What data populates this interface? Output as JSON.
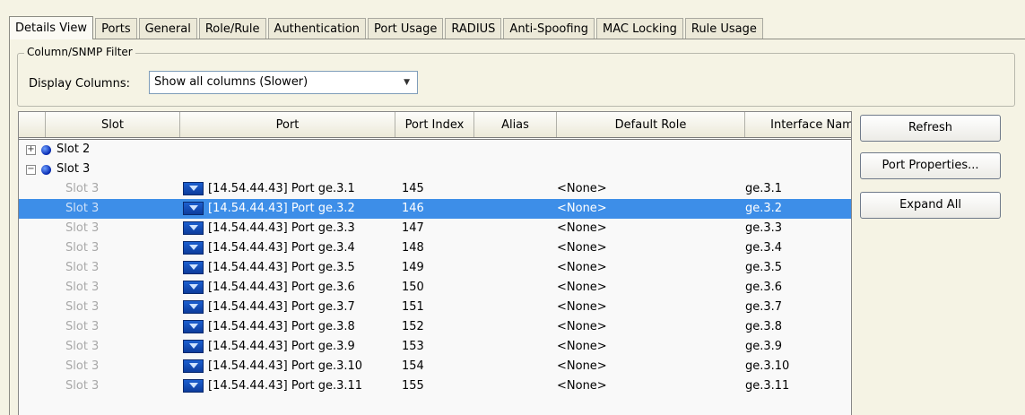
{
  "tabs": [
    "Details View",
    "Ports",
    "General",
    "Role/Rule",
    "Authentication",
    "Port Usage",
    "RADIUS",
    "Anti-Spoofing",
    "MAC Locking",
    "Rule Usage"
  ],
  "filter": {
    "group_title": "Column/SNMP Filter",
    "display_columns_label": "Display Columns:",
    "display_columns_value": "Show all columns (Slower)"
  },
  "table": {
    "columns": [
      "",
      "Slot",
      "Port",
      "Port Index",
      "Alias",
      "Default Role",
      "Interface Nam"
    ],
    "slots": [
      {
        "expander": "+",
        "label": "Slot 2"
      },
      {
        "expander": "−",
        "label": "Slot 3"
      }
    ],
    "rows": [
      {
        "slot": "Slot 3",
        "port": "[14.54.44.43] Port ge.3.1",
        "index": "145",
        "alias": "",
        "role": "<None>",
        "iface": "ge.3.1"
      },
      {
        "slot": "Slot 3",
        "port": "[14.54.44.43] Port ge.3.2",
        "index": "146",
        "alias": "",
        "role": "<None>",
        "iface": "ge.3.2",
        "selected": true
      },
      {
        "slot": "Slot 3",
        "port": "[14.54.44.43] Port ge.3.3",
        "index": "147",
        "alias": "",
        "role": "<None>",
        "iface": "ge.3.3"
      },
      {
        "slot": "Slot 3",
        "port": "[14.54.44.43] Port ge.3.4",
        "index": "148",
        "alias": "",
        "role": "<None>",
        "iface": "ge.3.4"
      },
      {
        "slot": "Slot 3",
        "port": "[14.54.44.43] Port ge.3.5",
        "index": "149",
        "alias": "",
        "role": "<None>",
        "iface": "ge.3.5"
      },
      {
        "slot": "Slot 3",
        "port": "[14.54.44.43] Port ge.3.6",
        "index": "150",
        "alias": "",
        "role": "<None>",
        "iface": "ge.3.6"
      },
      {
        "slot": "Slot 3",
        "port": "[14.54.44.43] Port ge.3.7",
        "index": "151",
        "alias": "",
        "role": "<None>",
        "iface": "ge.3.7"
      },
      {
        "slot": "Slot 3",
        "port": "[14.54.44.43] Port ge.3.8",
        "index": "152",
        "alias": "",
        "role": "<None>",
        "iface": "ge.3.8"
      },
      {
        "slot": "Slot 3",
        "port": "[14.54.44.43] Port ge.3.9",
        "index": "153",
        "alias": "",
        "role": "<None>",
        "iface": "ge.3.9"
      },
      {
        "slot": "Slot 3",
        "port": "[14.54.44.43] Port ge.3.10",
        "index": "154",
        "alias": "",
        "role": "<None>",
        "iface": "ge.3.10"
      },
      {
        "slot": "Slot 3",
        "port": "[14.54.44.43] Port ge.3.11",
        "index": "155",
        "alias": "",
        "role": "<None>",
        "iface": "ge.3.11"
      }
    ]
  },
  "buttons": {
    "refresh": "Refresh",
    "port_properties": "Port Properties...",
    "expand_all": "Expand All"
  },
  "colors": {
    "selection": "#3d8ee8",
    "slot_dot": "#0b2fb5"
  },
  "icons": {
    "slot": "blue-sphere-icon",
    "port": "port-icon",
    "expand": "plus-box-icon",
    "collapse": "minus-box-icon"
  }
}
